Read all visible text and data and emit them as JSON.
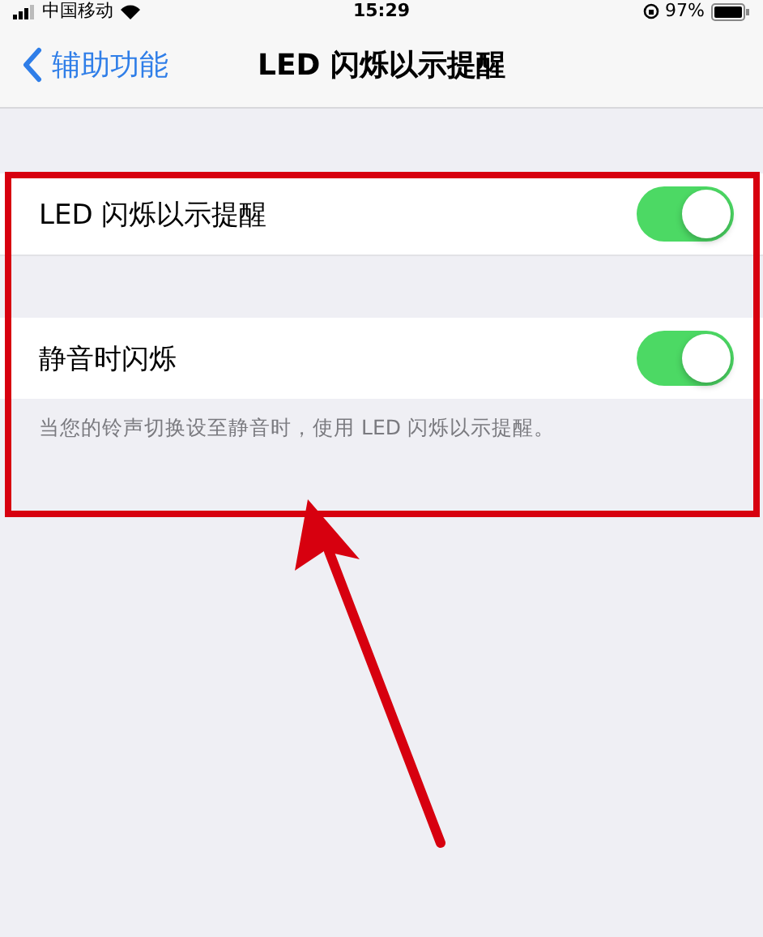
{
  "status_bar": {
    "carrier": "中国移动",
    "time": "15:29",
    "battery": "97%"
  },
  "nav_bar": {
    "back_label": "辅助功能",
    "title": "LED 闪烁以示提醒"
  },
  "settings": [
    {
      "label": "LED 闪烁以示提醒",
      "on": true
    },
    {
      "label": "静音时闪烁",
      "on": true
    }
  ],
  "footer_note": "当您的铃声切换设至静音时，使用 LED 闪烁以示提醒。"
}
